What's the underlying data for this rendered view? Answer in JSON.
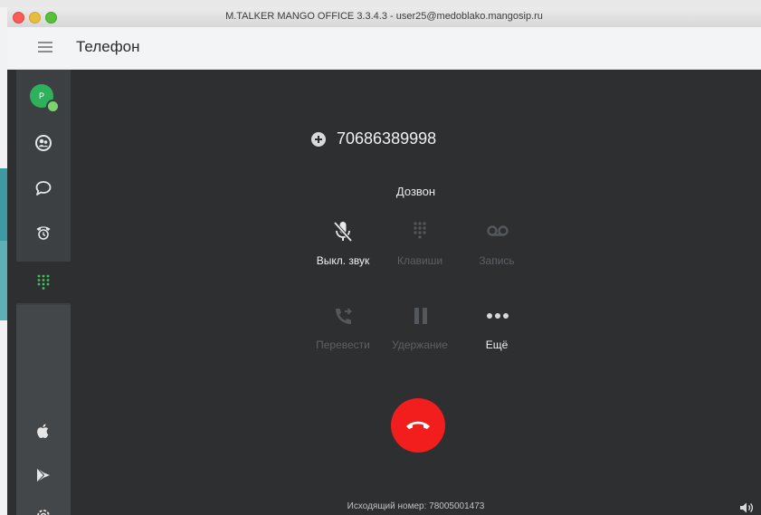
{
  "window": {
    "title": "M.TALKER MANGO OFFICE 3.3.4.3 - user25@medoblako.mangosip.ru"
  },
  "header": {
    "title": "Телефон",
    "menu_icon": "hamburger-menu-icon"
  },
  "sidebar": {
    "avatar_initial": "P",
    "items": [
      {
        "id": "contacts",
        "icon": "contacts-icon"
      },
      {
        "id": "chats",
        "icon": "chat-icon"
      },
      {
        "id": "history",
        "icon": "call-history-icon"
      },
      {
        "id": "dialpad",
        "icon": "dialpad-icon",
        "active": true
      },
      {
        "id": "apple",
        "icon": "apple-icon"
      },
      {
        "id": "google-play",
        "icon": "google-play-icon"
      },
      {
        "id": "settings",
        "icon": "gear-icon"
      }
    ]
  },
  "call": {
    "number": "70686389998",
    "status": "Дозвон",
    "controls": [
      {
        "id": "mute",
        "label": "Выкл. звук",
        "enabled": true,
        "icon": "mic-off-icon"
      },
      {
        "id": "keypad",
        "label": "Клавиши",
        "enabled": false,
        "icon": "keypad-icon"
      },
      {
        "id": "record",
        "label": "Запись",
        "enabled": false,
        "icon": "voicemail-icon"
      },
      {
        "id": "transfer",
        "label": "Перевести",
        "enabled": false,
        "icon": "transfer-call-icon"
      },
      {
        "id": "hold",
        "label": "Удержание",
        "enabled": false,
        "icon": "pause-icon"
      },
      {
        "id": "more",
        "label": "Ещё",
        "enabled": true,
        "icon": "more-dots-icon"
      }
    ],
    "outgoing_number": "Исходящий номер: 78005001473"
  },
  "colors": {
    "accent_green": "#2db15a",
    "hangup_red": "#f21d1d",
    "background": "#2d2f31",
    "sidebar": "#3c4043"
  }
}
